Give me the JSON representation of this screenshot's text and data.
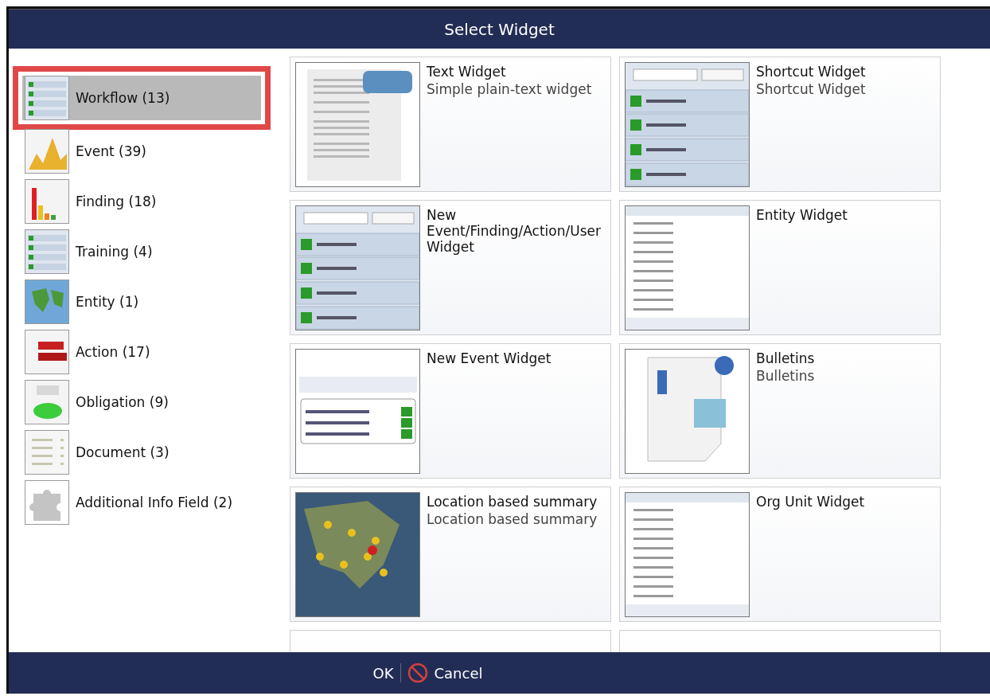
{
  "dialog": {
    "title": "Select Widget"
  },
  "categories": [
    {
      "label": "Workflow (13)",
      "kind": "list",
      "selected": true
    },
    {
      "label": "Event (39)",
      "kind": "area",
      "selected": false
    },
    {
      "label": "Finding (18)",
      "kind": "bars",
      "selected": false
    },
    {
      "label": "Training (4)",
      "kind": "list",
      "selected": false
    },
    {
      "label": "Entity (1)",
      "kind": "map",
      "selected": false
    },
    {
      "label": "Action (17)",
      "kind": "hbars",
      "selected": false
    },
    {
      "label": "Obligation (9)",
      "kind": "pie",
      "selected": false
    },
    {
      "label": "Document (3)",
      "kind": "doc",
      "selected": false
    },
    {
      "label": "Additional Info Field (2)",
      "kind": "puzzle",
      "selected": false
    }
  ],
  "widgets": [
    {
      "title": "Text Widget",
      "subtitle": "Simple plain-text widget",
      "kind": "text"
    },
    {
      "title": "Shortcut Widget",
      "subtitle": "Shortcut Widget",
      "kind": "shortcut"
    },
    {
      "title": "New Event/Finding/Action/User Widget",
      "kind": "shortcut"
    },
    {
      "title": "Entity Widget",
      "kind": "list"
    },
    {
      "title": "New Event Widget",
      "kind": "form"
    },
    {
      "title": "Bulletins",
      "subtitle": "Bulletins",
      "kind": "bulletin"
    },
    {
      "title": "Location based summary",
      "subtitle": "Location based summary",
      "kind": "map"
    },
    {
      "title": "Org Unit Widget",
      "kind": "list"
    },
    {
      "kind": "blank"
    },
    {
      "kind": "blank"
    }
  ],
  "footer": {
    "ok": "OK",
    "cancel": "Cancel"
  }
}
